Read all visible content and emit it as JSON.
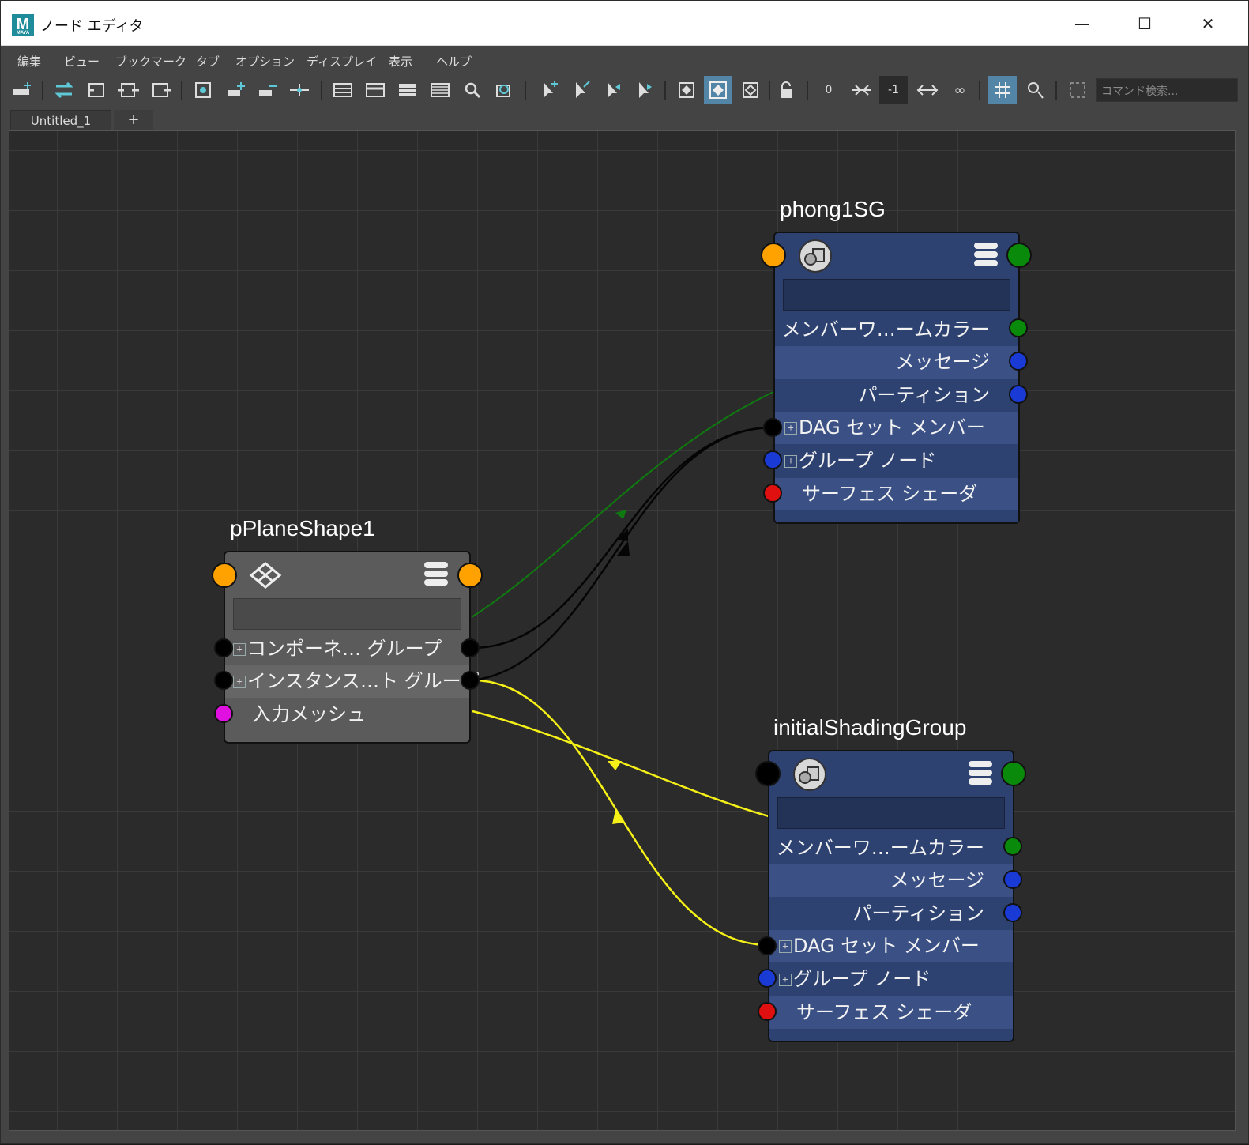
{
  "window": {
    "title": "ノード エディタ",
    "app_logo": "M",
    "app_logo_sub": "MAYA",
    "controls": {
      "minimize": "—",
      "maximize": "☐",
      "close": "✕"
    }
  },
  "menu": [
    "編集",
    "ビュー",
    "ブックマーク",
    "タブ",
    "オプション",
    "ディスプレイ",
    "表示",
    "ヘルプ"
  ],
  "toolbar": {
    "zero_label": "0",
    "neg_one_label": "-1",
    "search_placeholder": "コマンド検索..."
  },
  "tabs": {
    "active": "Untitled_1",
    "add": "+"
  },
  "nodes": {
    "phong": {
      "title": "phong1SG",
      "attrs": [
        "メンバーワ…ームカラー",
        "メッセージ",
        "パーティション",
        "DAG セット メンバー",
        "グループ ノード",
        "サーフェス シェーダ"
      ]
    },
    "initial": {
      "title": "initialShadingGroup",
      "attrs": [
        "メンバーワ…ームカラー",
        "メッセージ",
        "パーティション",
        "DAG セット メンバー",
        "グループ ノード",
        "サーフェス シェーダ"
      ]
    },
    "plane": {
      "title": "pPlaneShape1",
      "attrs": [
        "コンポーネ… グループ",
        "インスタンス…ト グループ",
        "入力メッシュ"
      ]
    }
  },
  "colors": {
    "port_orange": "#ffa200",
    "port_green": "#0a8a0a",
    "port_blue": "#1a3ad6",
    "port_red": "#e01010",
    "port_magenta": "#e010e0",
    "port_black": "#000000",
    "wire_green": "#0f7a0f",
    "wire_black": "#050505",
    "wire_yellow": "#f5f017",
    "active_button": "#5285a6"
  }
}
